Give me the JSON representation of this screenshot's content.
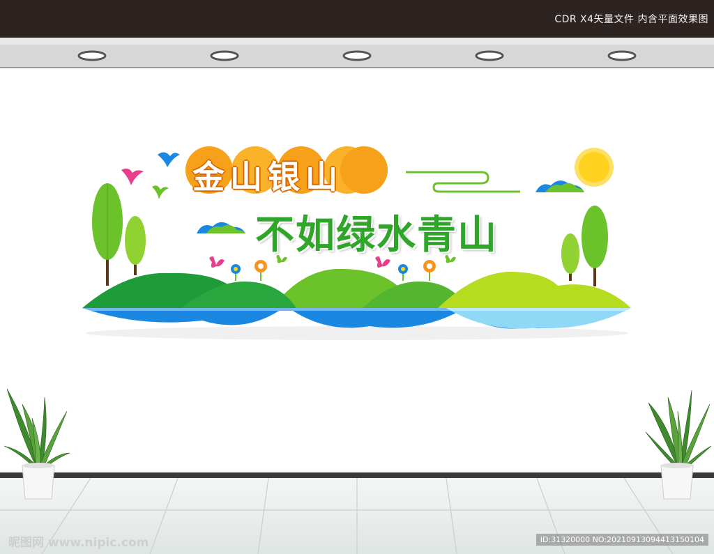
{
  "header": {
    "text": "CDR X4矢量文件  内含平面效果图"
  },
  "artwork": {
    "title_line1": "金山银山",
    "title_line2": "不如绿水青山"
  },
  "watermark": {
    "left_text": "昵图网 www.nipic.com",
    "right_text": "ID:31320000 NO:20210913094413150104"
  },
  "colors": {
    "topbar": "#2d2422",
    "title_orange": "#f7a11a",
    "title_green": "#2fa62a",
    "hill_dark": "#1e9c3a",
    "hill_mid": "#6cc22a",
    "hill_light": "#b5dc1e",
    "water_dark": "#1a88e0",
    "water_light": "#8fd8f6",
    "sun": "#ffd21f"
  }
}
